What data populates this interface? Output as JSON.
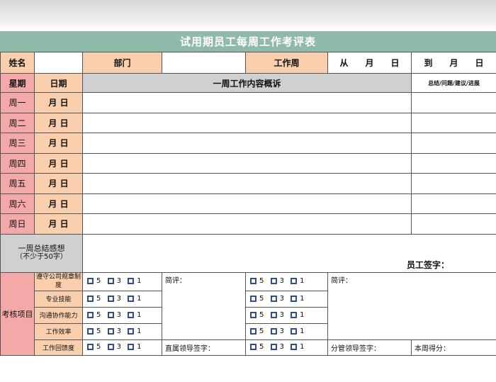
{
  "title": "试用期员工每周工作考评表",
  "header": {
    "name_label": "姓名",
    "dept_label": "部门",
    "week_label": "工作周",
    "from_text": "从　　月　　日",
    "to_text": "到　　月　　日"
  },
  "columns": {
    "weekday": "星期",
    "date": "日期",
    "summary": "一周工作内容概诉",
    "notes": "总结/问题/建议/进展"
  },
  "days": [
    {
      "weekday": "周一",
      "date": "月 日"
    },
    {
      "weekday": "周二",
      "date": "月 日"
    },
    {
      "weekday": "周三",
      "date": "月 日"
    },
    {
      "weekday": "周四",
      "date": "月 日"
    },
    {
      "weekday": "周五",
      "date": "月 日"
    },
    {
      "weekday": "周六",
      "date": "月 日"
    },
    {
      "weekday": "周日",
      "date": "月 日"
    }
  ],
  "weekly_reflection": {
    "label_line1": "一周总结感想",
    "label_line2": "（不少于50字）",
    "signature_label": "员工签字："
  },
  "assessment": {
    "section_label": "考核项目",
    "items": [
      "遵守公司规章制度",
      "专业技能",
      "沟通协作能力",
      "工作效率",
      "工作回馈度"
    ],
    "options": [
      "5",
      "3",
      "1"
    ],
    "comment_label": "简评：",
    "direct_leader_sign": "直属领导签字：",
    "branch_leader_sign": "分管领导签字：",
    "week_score": "本周得分："
  },
  "colors": {
    "title_bg": "#8fb9a8",
    "peach": "#f9cfae",
    "pink": "#f4a9a9",
    "gray": "#d0d0d0",
    "checkbox": "#2e4d8c"
  }
}
